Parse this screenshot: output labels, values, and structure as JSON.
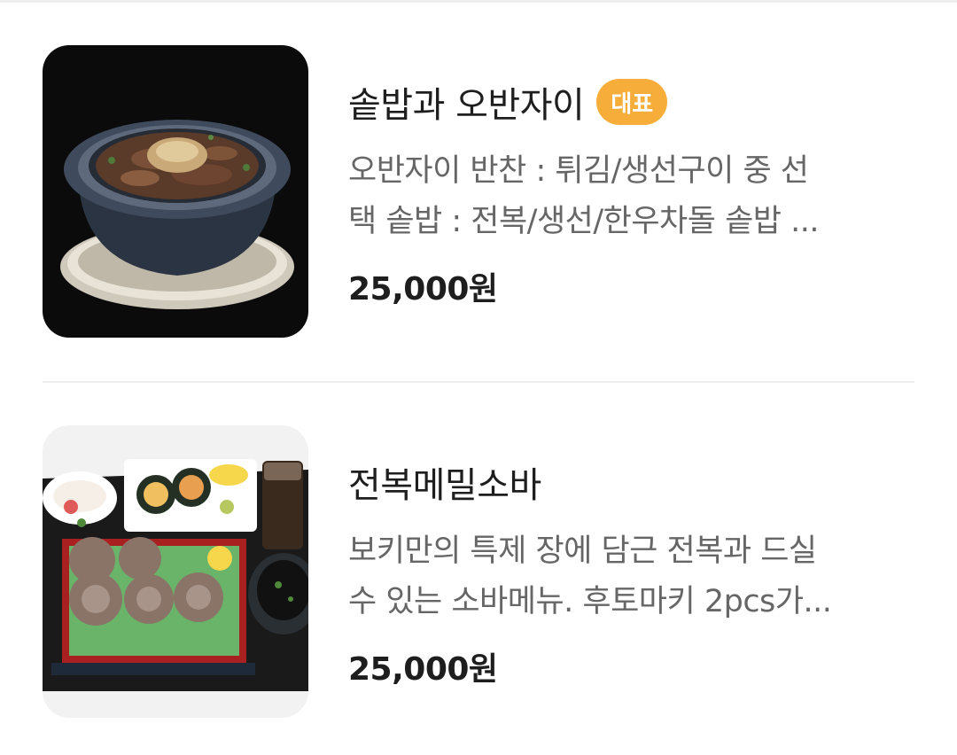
{
  "menu": {
    "items": [
      {
        "name": "솥밥과 오반자이",
        "badge": "대표",
        "description_line1": "오반자이 반찬 : 튀김/생선구이 중 선",
        "description_line2": "택 솥밥 : 전복/생선/한우차돌 솥밥 ...",
        "price": "25,000원",
        "image_icon": "rice-pot-photo"
      },
      {
        "name": "전복메밀소바",
        "description_line1": "보키만의 특제 장에 담근 전복과 드실",
        "description_line2": "수 있는 소바메뉴. 후토마키 2pcs가...",
        "price": "25,000원",
        "image_icon": "soba-set-photo"
      }
    ]
  },
  "colors": {
    "badge": "#f7ad3a",
    "divider": "#eeeeee",
    "title": "#1e1e1e",
    "description": "#666666"
  }
}
